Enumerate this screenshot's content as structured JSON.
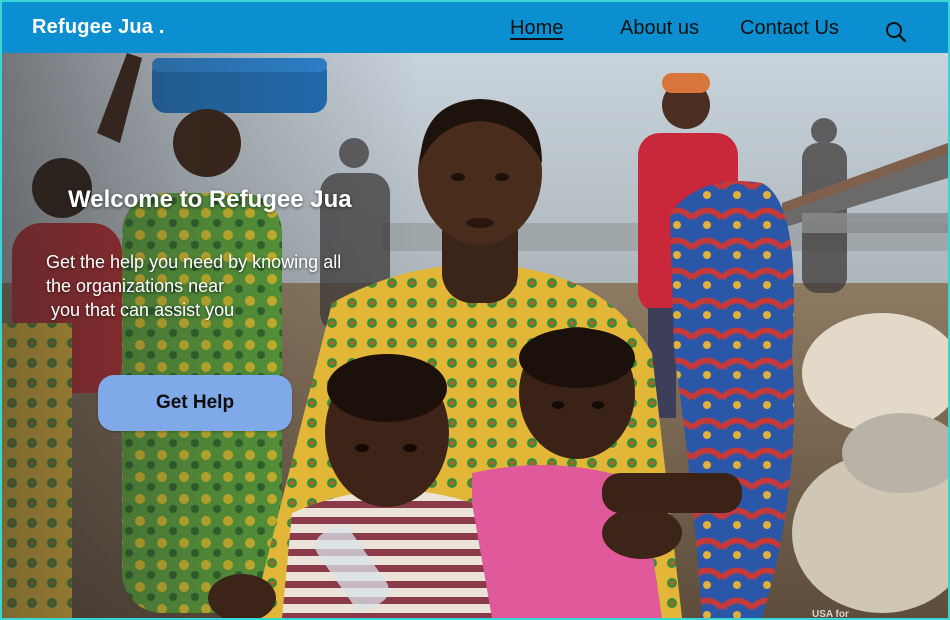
{
  "nav": {
    "brand": "Refugee Jua .",
    "links": [
      {
        "label": "Home",
        "active": true
      },
      {
        "label": "About us",
        "active": false
      },
      {
        "label": "Contact Us",
        "active": false
      }
    ],
    "search_icon": "search-icon",
    "background": "#0b8fd0"
  },
  "hero": {
    "title": "Welcome to Refugee Jua",
    "subtitle_lines": [
      "Get the help you need by knowing all",
      "the organizations near",
      "you that can assist you"
    ],
    "cta_label": "Get Help",
    "cta_color": "#7fa9e8",
    "photo_watermark": "USA for"
  },
  "colors": {
    "accent": "#0b8fd0",
    "frame": "#3ad6d6"
  }
}
